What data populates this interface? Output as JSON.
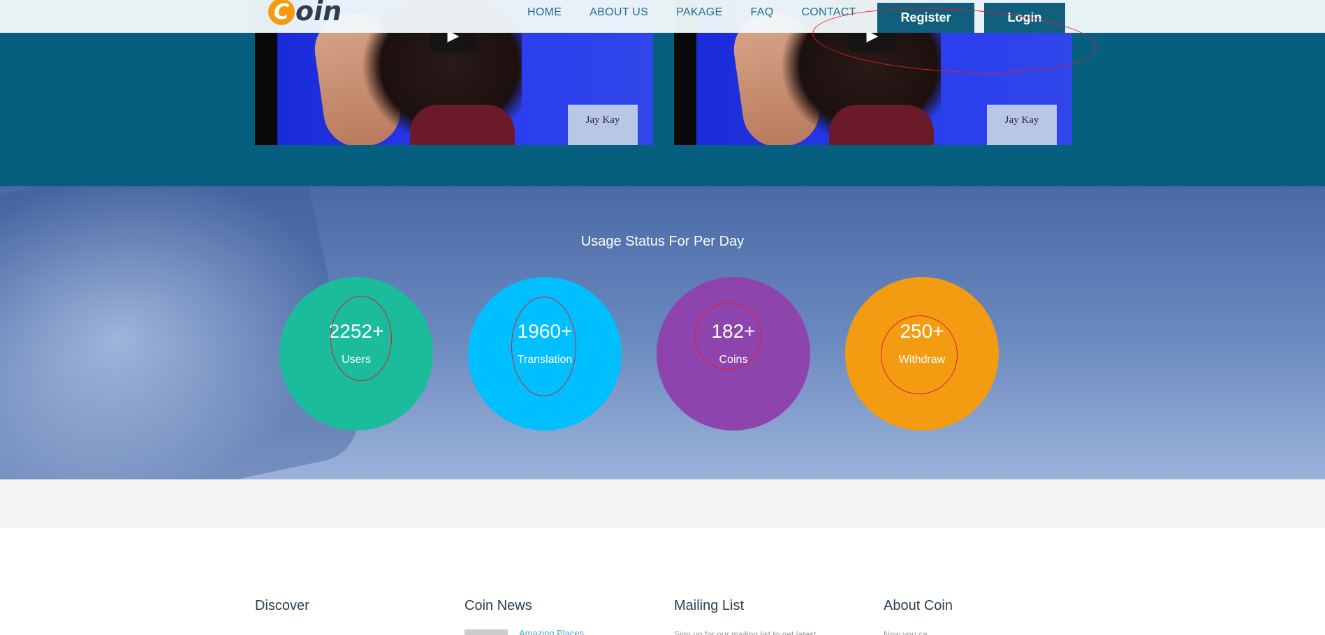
{
  "header": {
    "logo_letter": "C",
    "logo_rest": "oin",
    "nav": [
      "HOME",
      "ABOUT US",
      "PAKAGE",
      "FAQ",
      "CONTACT"
    ],
    "register_label": "Register",
    "login_label": "Login"
  },
  "videos": [
    {
      "caption": "Jay Kay"
    },
    {
      "caption": "Jay Kay"
    }
  ],
  "stats": {
    "title": "Usage Status For Per Day",
    "items": [
      {
        "value": "2252+",
        "label": "Users",
        "color": "#1abc9c"
      },
      {
        "value": "1960+",
        "label": "Translation",
        "color": "#00bfff"
      },
      {
        "value": "182+",
        "label": "Coins",
        "color": "#8e44ad"
      },
      {
        "value": "250+",
        "label": "Withdraw",
        "color": "#f39c12"
      }
    ]
  },
  "footer": {
    "columns": [
      {
        "title": "Discover"
      },
      {
        "title": "Coin News"
      },
      {
        "title": "Mailing List"
      },
      {
        "title": "About Coin"
      }
    ],
    "news_link": "Amazing Places",
    "mailing_text": "Sign up for our mailing list to get latest",
    "about_text": "Now you ca..."
  },
  "colors": {
    "primary": "#0f5f7d",
    "annotation": "#e11d2a"
  }
}
